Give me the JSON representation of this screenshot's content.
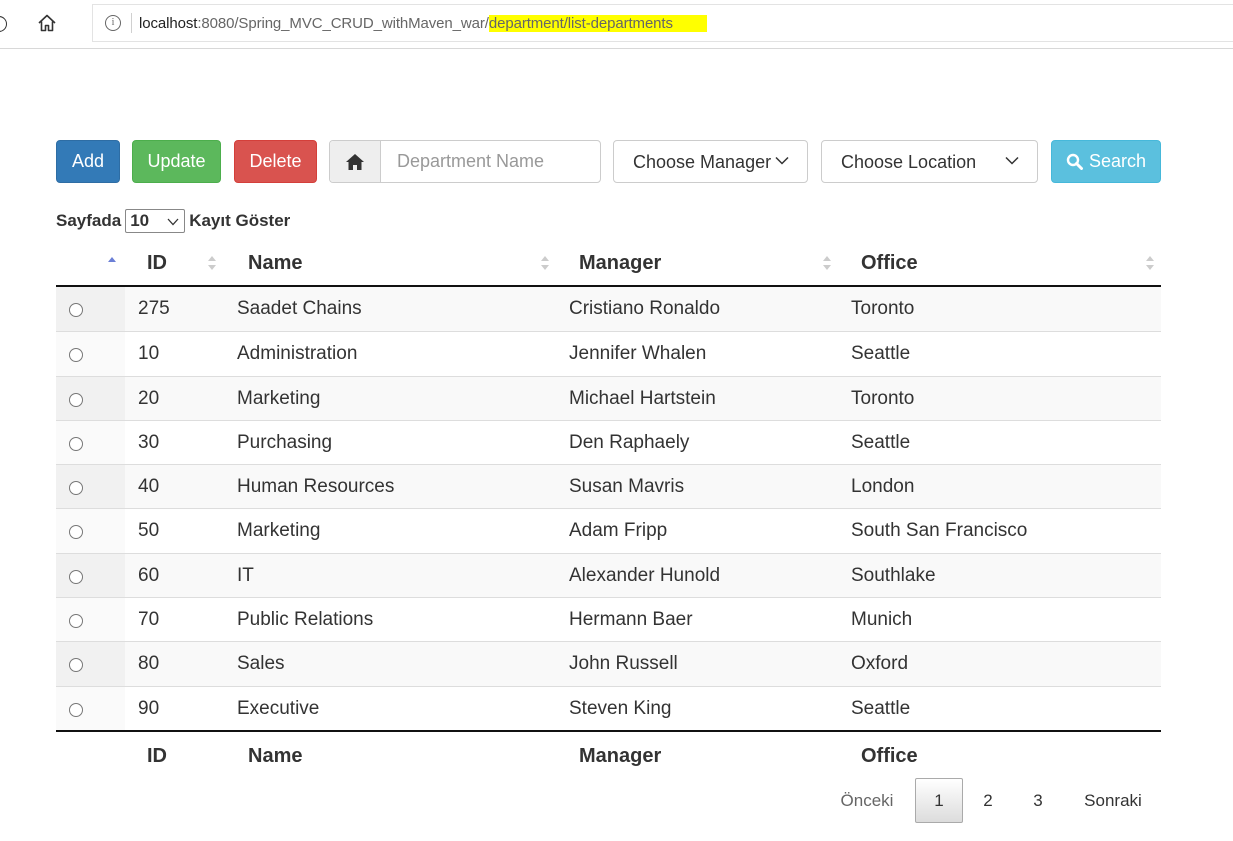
{
  "browser": {
    "url_host": "localhost",
    "url_mid": ":8080/Spring_MVC_CRUD_withMaven_war/",
    "url_highlight": "department/list-departments",
    "info_glyph": "i"
  },
  "toolbar": {
    "add_label": "Add",
    "update_label": "Update",
    "delete_label": "Delete",
    "search_label": "Search",
    "department_placeholder": "Department Name",
    "manager_select": "Choose Manager",
    "location_select": "Choose Location"
  },
  "length_control": {
    "prefix": "Sayfada",
    "value": "10",
    "suffix": "Kayıt Göster"
  },
  "table": {
    "columns": [
      "ID",
      "Name",
      "Manager",
      "Office"
    ],
    "rows": [
      {
        "id": "275",
        "name": "Saadet Chains",
        "manager": "Cristiano Ronaldo",
        "office": "Toronto"
      },
      {
        "id": "10",
        "name": "Administration",
        "manager": "Jennifer Whalen",
        "office": "Seattle"
      },
      {
        "id": "20",
        "name": "Marketing",
        "manager": "Michael Hartstein",
        "office": "Toronto"
      },
      {
        "id": "30",
        "name": "Purchasing",
        "manager": "Den Raphaely",
        "office": "Seattle"
      },
      {
        "id": "40",
        "name": "Human Resources",
        "manager": "Susan Mavris",
        "office": "London"
      },
      {
        "id": "50",
        "name": "Marketing",
        "manager": "Adam Fripp",
        "office": "South San Francisco"
      },
      {
        "id": "60",
        "name": "IT",
        "manager": "Alexander Hunold",
        "office": "Southlake"
      },
      {
        "id": "70",
        "name": "Public Relations",
        "manager": "Hermann Baer",
        "office": "Munich"
      },
      {
        "id": "80",
        "name": "Sales",
        "manager": "John Russell",
        "office": "Oxford"
      },
      {
        "id": "90",
        "name": "Executive",
        "manager": "Steven King",
        "office": "Seattle"
      }
    ]
  },
  "pagination": {
    "previous": "Önceki",
    "pages": [
      "1",
      "2",
      "3"
    ],
    "next": "Sonraki"
  },
  "colors": {
    "add": "#337ab7",
    "update": "#5cb85c",
    "delete": "#d9534f",
    "search": "#5bc0de",
    "url_highlight": "#ffff00",
    "sort_active": "#6b7fd6"
  }
}
